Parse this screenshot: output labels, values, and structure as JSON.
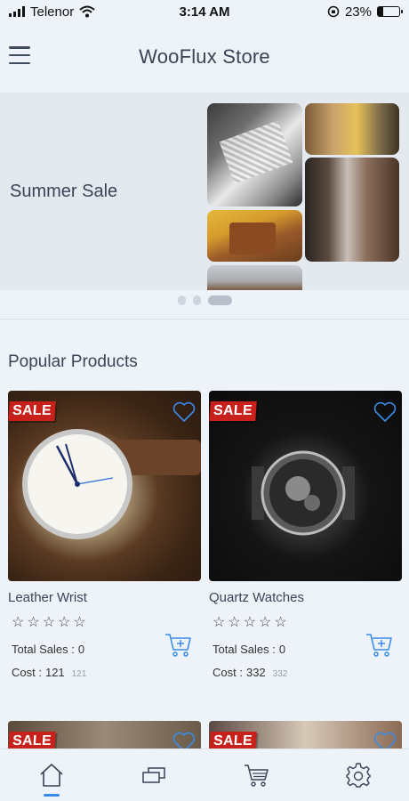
{
  "status_bar": {
    "carrier": "Telenor",
    "time": "3:14 AM",
    "battery_text": "23%",
    "battery_level": 0.23
  },
  "header": {
    "title": "WooFlux Store"
  },
  "banner": {
    "title": "Summer Sale",
    "page_count": 3,
    "active_page": 3
  },
  "section": {
    "title": "Popular Products"
  },
  "products": [
    {
      "name": "Leather Wrist",
      "badge": "SALE",
      "rating": 0,
      "total_sales_label": "Total Sales :",
      "total_sales": "0",
      "cost_label": "Cost :",
      "cost": "121",
      "regular_price": "121"
    },
    {
      "name": "Quartz Watches",
      "badge": "SALE",
      "rating": 0,
      "total_sales_label": "Total Sales :",
      "total_sales": "0",
      "cost_label": "Cost :",
      "cost": "332",
      "regular_price": "332"
    }
  ],
  "peek_badges": [
    "SALE",
    "SALE"
  ],
  "nav": {
    "items": [
      "home-icon",
      "categories-icon",
      "cart-icon",
      "settings-icon"
    ],
    "active": "home-icon"
  },
  "colors": {
    "accent": "#3b8ce8",
    "sale": "#c8201a",
    "background": "#eef3fa"
  }
}
